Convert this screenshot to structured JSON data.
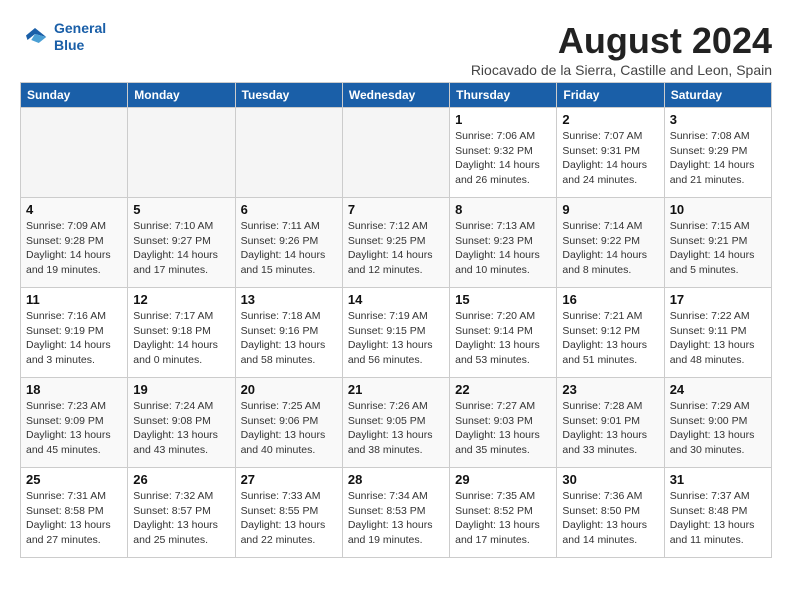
{
  "header": {
    "logo_line1": "General",
    "logo_line2": "Blue",
    "month_title": "August 2024",
    "subtitle": "Riocavado de la Sierra, Castille and Leon, Spain"
  },
  "weekdays": [
    "Sunday",
    "Monday",
    "Tuesday",
    "Wednesday",
    "Thursday",
    "Friday",
    "Saturday"
  ],
  "weeks": [
    [
      {
        "day": "",
        "info": ""
      },
      {
        "day": "",
        "info": ""
      },
      {
        "day": "",
        "info": ""
      },
      {
        "day": "",
        "info": ""
      },
      {
        "day": "1",
        "info": "Sunrise: 7:06 AM\nSunset: 9:32 PM\nDaylight: 14 hours\nand 26 minutes."
      },
      {
        "day": "2",
        "info": "Sunrise: 7:07 AM\nSunset: 9:31 PM\nDaylight: 14 hours\nand 24 minutes."
      },
      {
        "day": "3",
        "info": "Sunrise: 7:08 AM\nSunset: 9:29 PM\nDaylight: 14 hours\nand 21 minutes."
      }
    ],
    [
      {
        "day": "4",
        "info": "Sunrise: 7:09 AM\nSunset: 9:28 PM\nDaylight: 14 hours\nand 19 minutes."
      },
      {
        "day": "5",
        "info": "Sunrise: 7:10 AM\nSunset: 9:27 PM\nDaylight: 14 hours\nand 17 minutes."
      },
      {
        "day": "6",
        "info": "Sunrise: 7:11 AM\nSunset: 9:26 PM\nDaylight: 14 hours\nand 15 minutes."
      },
      {
        "day": "7",
        "info": "Sunrise: 7:12 AM\nSunset: 9:25 PM\nDaylight: 14 hours\nand 12 minutes."
      },
      {
        "day": "8",
        "info": "Sunrise: 7:13 AM\nSunset: 9:23 PM\nDaylight: 14 hours\nand 10 minutes."
      },
      {
        "day": "9",
        "info": "Sunrise: 7:14 AM\nSunset: 9:22 PM\nDaylight: 14 hours\nand 8 minutes."
      },
      {
        "day": "10",
        "info": "Sunrise: 7:15 AM\nSunset: 9:21 PM\nDaylight: 14 hours\nand 5 minutes."
      }
    ],
    [
      {
        "day": "11",
        "info": "Sunrise: 7:16 AM\nSunset: 9:19 PM\nDaylight: 14 hours\nand 3 minutes."
      },
      {
        "day": "12",
        "info": "Sunrise: 7:17 AM\nSunset: 9:18 PM\nDaylight: 14 hours\nand 0 minutes."
      },
      {
        "day": "13",
        "info": "Sunrise: 7:18 AM\nSunset: 9:16 PM\nDaylight: 13 hours\nand 58 minutes."
      },
      {
        "day": "14",
        "info": "Sunrise: 7:19 AM\nSunset: 9:15 PM\nDaylight: 13 hours\nand 56 minutes."
      },
      {
        "day": "15",
        "info": "Sunrise: 7:20 AM\nSunset: 9:14 PM\nDaylight: 13 hours\nand 53 minutes."
      },
      {
        "day": "16",
        "info": "Sunrise: 7:21 AM\nSunset: 9:12 PM\nDaylight: 13 hours\nand 51 minutes."
      },
      {
        "day": "17",
        "info": "Sunrise: 7:22 AM\nSunset: 9:11 PM\nDaylight: 13 hours\nand 48 minutes."
      }
    ],
    [
      {
        "day": "18",
        "info": "Sunrise: 7:23 AM\nSunset: 9:09 PM\nDaylight: 13 hours\nand 45 minutes."
      },
      {
        "day": "19",
        "info": "Sunrise: 7:24 AM\nSunset: 9:08 PM\nDaylight: 13 hours\nand 43 minutes."
      },
      {
        "day": "20",
        "info": "Sunrise: 7:25 AM\nSunset: 9:06 PM\nDaylight: 13 hours\nand 40 minutes."
      },
      {
        "day": "21",
        "info": "Sunrise: 7:26 AM\nSunset: 9:05 PM\nDaylight: 13 hours\nand 38 minutes."
      },
      {
        "day": "22",
        "info": "Sunrise: 7:27 AM\nSunset: 9:03 PM\nDaylight: 13 hours\nand 35 minutes."
      },
      {
        "day": "23",
        "info": "Sunrise: 7:28 AM\nSunset: 9:01 PM\nDaylight: 13 hours\nand 33 minutes."
      },
      {
        "day": "24",
        "info": "Sunrise: 7:29 AM\nSunset: 9:00 PM\nDaylight: 13 hours\nand 30 minutes."
      }
    ],
    [
      {
        "day": "25",
        "info": "Sunrise: 7:31 AM\nSunset: 8:58 PM\nDaylight: 13 hours\nand 27 minutes."
      },
      {
        "day": "26",
        "info": "Sunrise: 7:32 AM\nSunset: 8:57 PM\nDaylight: 13 hours\nand 25 minutes."
      },
      {
        "day": "27",
        "info": "Sunrise: 7:33 AM\nSunset: 8:55 PM\nDaylight: 13 hours\nand 22 minutes."
      },
      {
        "day": "28",
        "info": "Sunrise: 7:34 AM\nSunset: 8:53 PM\nDaylight: 13 hours\nand 19 minutes."
      },
      {
        "day": "29",
        "info": "Sunrise: 7:35 AM\nSunset: 8:52 PM\nDaylight: 13 hours\nand 17 minutes."
      },
      {
        "day": "30",
        "info": "Sunrise: 7:36 AM\nSunset: 8:50 PM\nDaylight: 13 hours\nand 14 minutes."
      },
      {
        "day": "31",
        "info": "Sunrise: 7:37 AM\nSunset: 8:48 PM\nDaylight: 13 hours\nand 11 minutes."
      }
    ]
  ]
}
